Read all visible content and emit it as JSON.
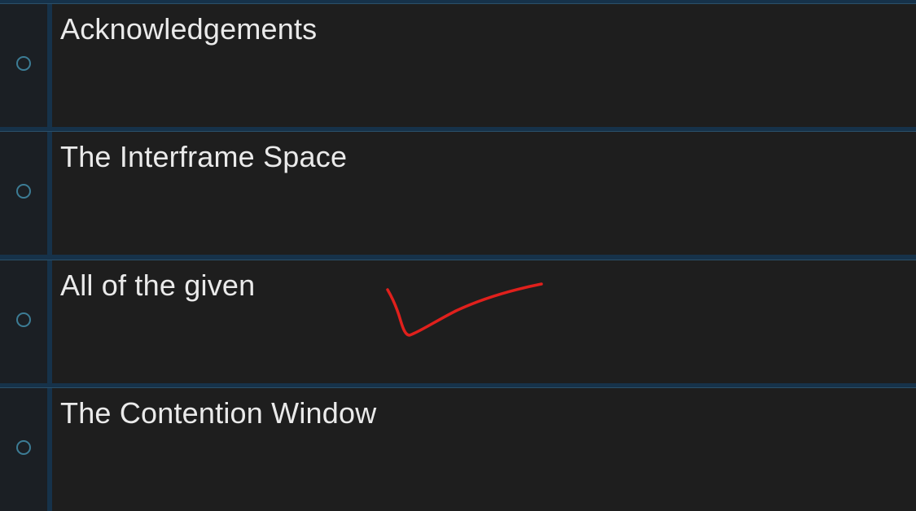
{
  "question": {
    "options": [
      {
        "label": "Acknowledgements",
        "selected": false
      },
      {
        "label": "The Interframe Space",
        "selected": false
      },
      {
        "label": "All of the given",
        "selected": false
      },
      {
        "label": "The Contention Window",
        "selected": false
      }
    ]
  },
  "colors": {
    "background": "#1e1e1e",
    "radio_cell": "#1b1f24",
    "radio_border": "#3c7c95",
    "divider": "#16324a",
    "text": "#eaeaea",
    "annotation": "#e0201c"
  },
  "annotation": {
    "type": "checkmark",
    "target_option": "All of the given"
  }
}
